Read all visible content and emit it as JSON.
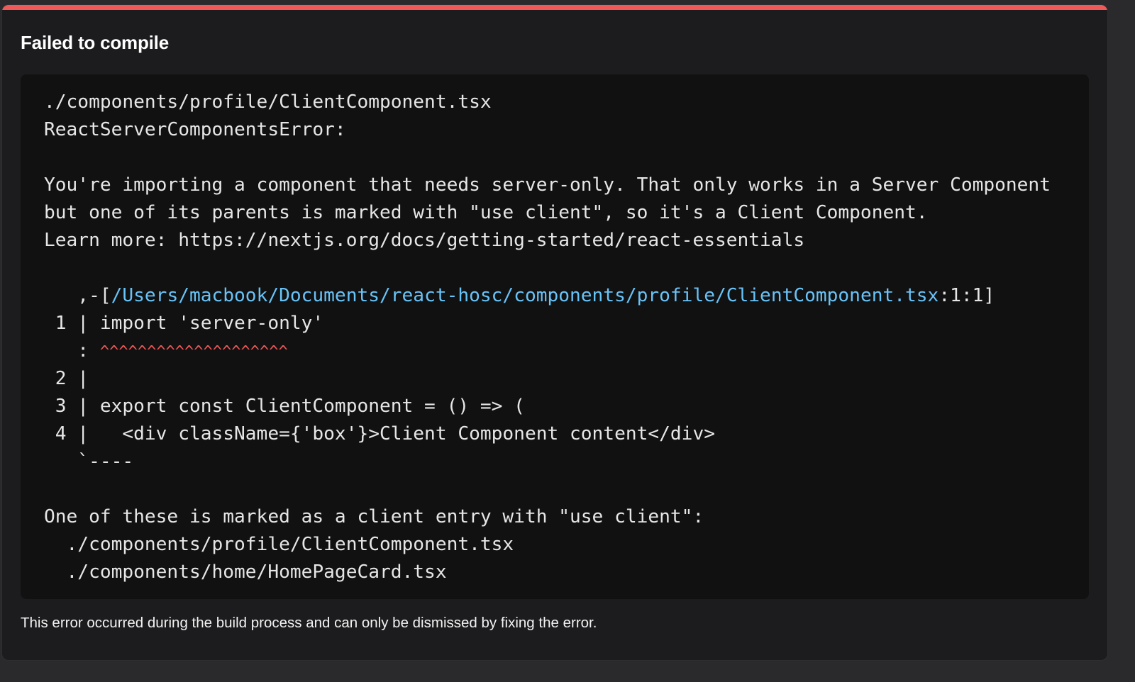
{
  "dialog": {
    "title": "Failed to compile",
    "footer": "This error occurred during the build process and can only be dismissed by fixing the error.",
    "accent_color": "#ee5a5a"
  },
  "error": {
    "file": "./components/profile/ClientComponent.tsx",
    "error_type": "ReactServerComponentsError:",
    "message_line1": "You're importing a component that needs server-only. That only works in a Server Component",
    "message_line2": "but one of its parents is marked with \"use client\", so it's a Client Component.",
    "learn_more": "Learn more: https://nextjs.org/docs/getting-started/react-essentials",
    "frame_prefix": "   ,-[",
    "frame_path": "/Users/macbook/Documents/react-hosc/components/profile/ClientComponent.tsx",
    "frame_suffix": ":1:1]",
    "code_lines": [
      " 1 | import 'server-only'",
      "   : ",
      " 2 |",
      " 3 | export const ClientComponent = () => (",
      " 4 |   <div className={'box'}>Client Component content</div>",
      "   `----"
    ],
    "squiggle": "^^^^^^^^^^^^^^^^^^^^",
    "client_entry_intro": "One of these is marked as a client entry with \"use client\":",
    "client_entries": [
      "  ./components/profile/ClientComponent.tsx",
      "  ./components/home/HomePageCard.tsx"
    ]
  }
}
